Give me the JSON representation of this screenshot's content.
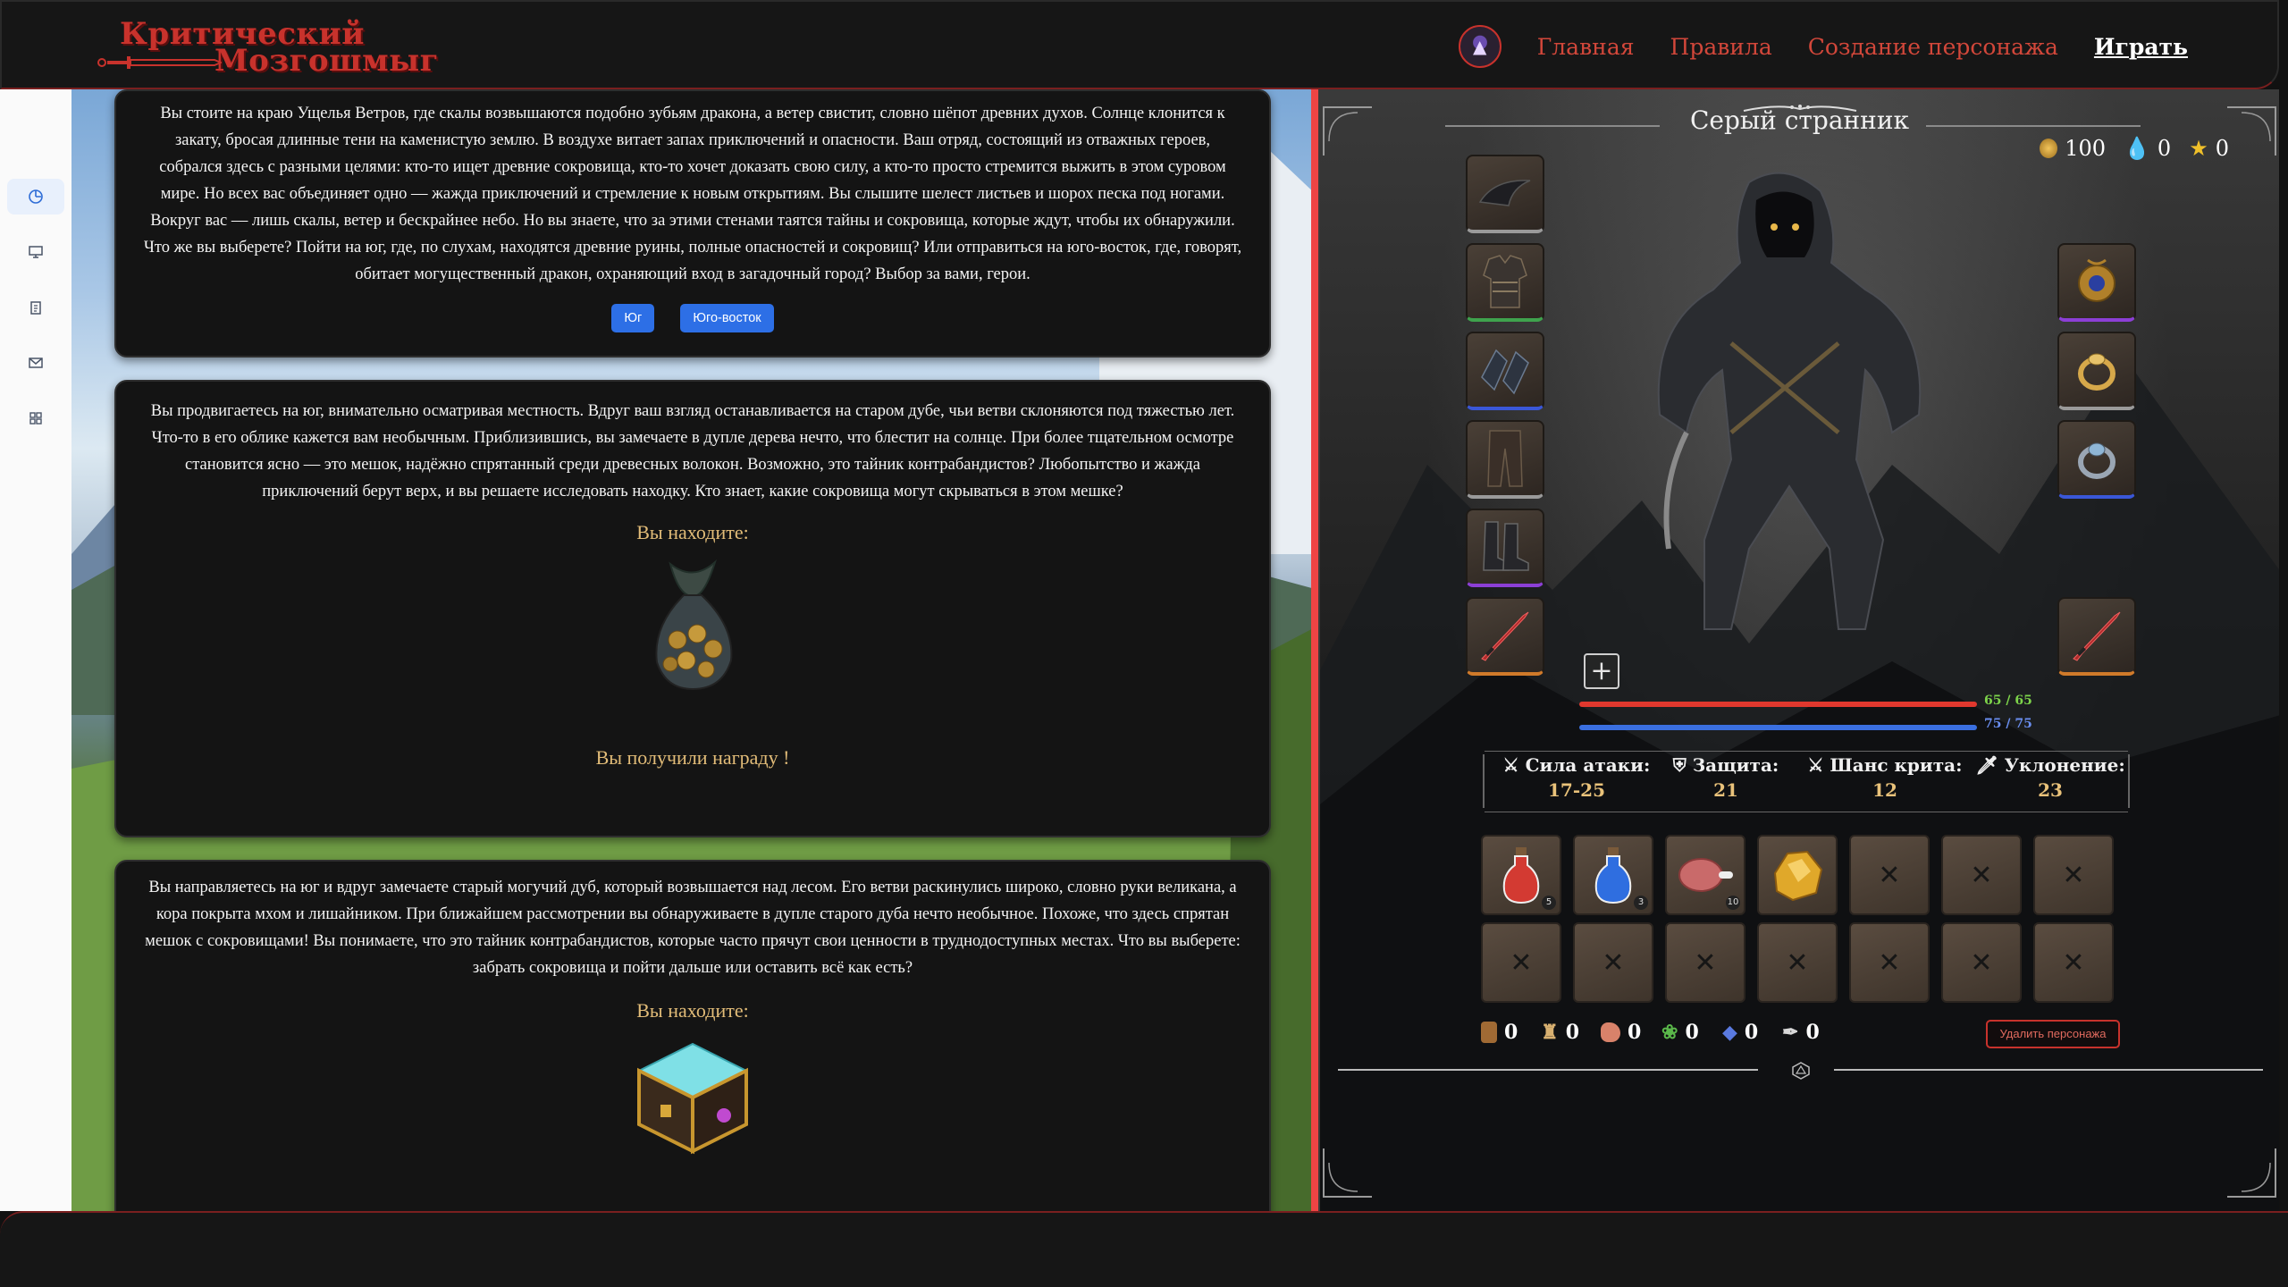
{
  "header": {
    "logo_line1": "Критический",
    "logo_line2": "Мозгошмыг",
    "nav": [
      "Главная",
      "Правила",
      "Создание персонажа",
      "Играть"
    ]
  },
  "sidebar": {
    "icons": [
      "chart-pie-icon",
      "monitor-icon",
      "clipboard-icon",
      "mail-icon",
      "grid-icon"
    ]
  },
  "story": {
    "cards": [
      {
        "text": "Вы стоите на краю Ущелья Ветров, где скалы возвышаются подобно зубьям дракона, а ветер свистит, словно шёпот древних духов. Солнце клонится к закату, бросая длинные тени на каменистую землю. В воздухе витает запах приключений и опасности. Ваш отряд, состоящий из отважных героев, собрался здесь с разными целями: кто-то ищет древние сокровища, кто-то хочет доказать свою силу, а кто-то просто стремится выжить в этом суровом мире. Но всех вас объединяет одно — жажда приключений и стремление к новым открытиям. Вы слышите шелест листьев и шорох песка под ногами. Вокруг вас — лишь скалы, ветер и бескрайнее небо. Но вы знаете, что за этими стенами таятся тайны и сокровища, которые ждут, чтобы их обнаружили. Что же вы выберете? Пойти на юг, где, по слухам, находятся древние руины, полные опасностей и сокровищ? Или отправиться на юго-восток, где, говорят, обитает могущественный дракон, охраняющий вход в загадочный город? Выбор за вами, герои.",
        "choices": [
          "Юг",
          "Юго-восток"
        ]
      },
      {
        "text": "Вы продвигаетесь на юг, внимательно осматривая местность. Вдруг ваш взгляд останавливается на старом дубе, чьи ветви склоняются под тяжестью лет. Что-то в его облике кажется вам необычным. Приблизившись, вы замечаете в дупле дерева нечто, что блестит на солнце. При более тщательном осмотре становится ясно — это мешок, надёжно спрятанный среди древесных волокон. Возможно, это тайник контрабандистов? Любопытство и жажда приключений берут верх, и вы решаете исследовать находку. Кто знает, какие сокровища могут скрываться в этом мешке?",
        "found_label": "Вы находите:",
        "reward_label": "Вы получили награду !"
      },
      {
        "text": "Вы направляетесь на юг и вдруг замечаете старый могучий дуб, который возвышается над лесом. Его ветви раскинулись широко, словно руки великана, а кора покрыта мхом и лишайником. При ближайшем рассмотрении вы обнаруживаете в дупле старого дуба нечто необычное. Похоже, что здесь спрятан мешок с сокровищами! Вы понимаете, что это тайник контрабандистов, которые часто прячут свои ценности в труднодоступных местах. Что вы выберете: забрать сокровища и пойти дальше или оставить всё как есть?",
        "found_label": "Вы находите:"
      }
    ]
  },
  "character": {
    "name": "Серый странник",
    "gold": "100",
    "mana": "0",
    "stars": "0",
    "hp_text": "65 / 65",
    "hp_fraction": 1.0,
    "mp_text": "75 / 75",
    "mp_fraction": 1.0,
    "hp_color": "#e0382e",
    "mp_color": "#3a6fe0",
    "stats": [
      {
        "label": "Сила атаки:",
        "value": "17-25",
        "icon": "sword-icon"
      },
      {
        "label": "Защита:",
        "value": "21",
        "icon": "shield-icon"
      },
      {
        "label": "Шанс крита:",
        "value": "12",
        "icon": "crossed-swords-icon"
      },
      {
        "label": "Уклонение:",
        "value": "23",
        "icon": "dagger-icon"
      }
    ],
    "inventory": [
      {
        "item": "red-potion-icon",
        "count": "5"
      },
      {
        "item": "blue-potion-icon",
        "count": "3"
      },
      {
        "item": "meat-icon",
        "count": "10"
      },
      {
        "item": "gold-ore-icon",
        "count": ""
      },
      {
        "item": "empty",
        "count": ""
      },
      {
        "item": "empty",
        "count": ""
      },
      {
        "item": "empty",
        "count": ""
      },
      {
        "item": "empty",
        "count": ""
      },
      {
        "item": "empty",
        "count": ""
      },
      {
        "item": "empty",
        "count": ""
      },
      {
        "item": "empty",
        "count": ""
      },
      {
        "item": "empty",
        "count": ""
      },
      {
        "item": "empty",
        "count": ""
      },
      {
        "item": "empty",
        "count": ""
      }
    ],
    "resources": [
      {
        "icon": "wood-icon",
        "value": "0"
      },
      {
        "icon": "helmet-icon",
        "value": "0"
      },
      {
        "icon": "hide-icon",
        "value": "0"
      },
      {
        "icon": "herb-icon",
        "value": "0"
      },
      {
        "icon": "gem-icon",
        "value": "0"
      },
      {
        "icon": "feather-icon",
        "value": "0"
      }
    ],
    "delete_label": "Удалить персонажа"
  }
}
